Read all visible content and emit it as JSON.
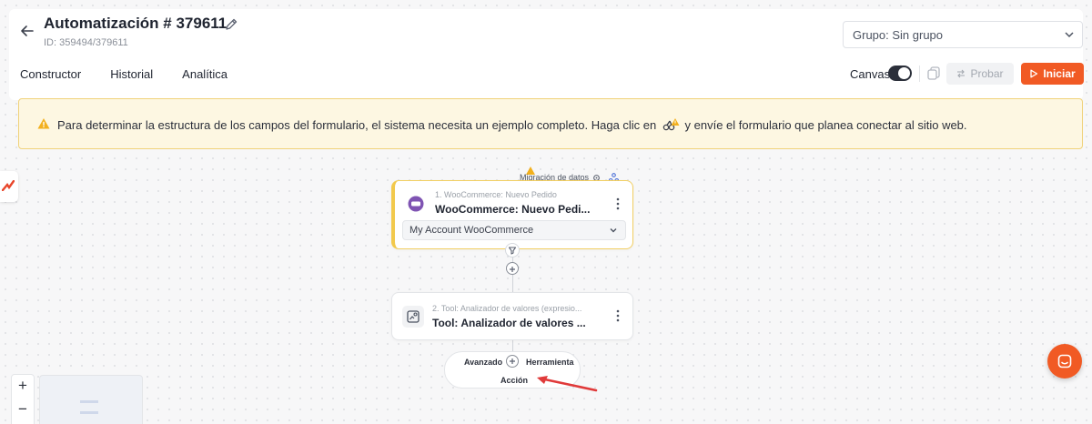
{
  "header": {
    "title": "Automatización # 379611",
    "id_text": "ID: 359494/379611",
    "group_select": "Grupo: Sin grupo"
  },
  "tabs": [
    {
      "label": "Constructor"
    },
    {
      "label": "Historial"
    },
    {
      "label": "Analítica"
    }
  ],
  "toolbar": {
    "canvas_label": "Canvas",
    "probar_label": "Probar",
    "iniciar_label": "Iniciar"
  },
  "alert": {
    "text_before": "Para determinar la estructura de los campos del formulario, el sistema necesita un ejemplo completo. Haga clic en",
    "text_after": "y envíe el formulario que planea conectar al sitio web."
  },
  "flow": {
    "migration_label": "Migración de datos",
    "node1": {
      "subtitle": "1. WooCommerce: Nuevo Pedido",
      "title": "WooCommerce: Nuevo Pedi...",
      "account": "My Account WooCommerce"
    },
    "node2": {
      "subtitle": "2. Tool: Analizador de valores (expresio...",
      "title": "Tool: Analizador de valores ..."
    },
    "add_menu": {
      "advanced": "Avanzado",
      "tool": "Herramienta",
      "action": "Acción"
    }
  },
  "zoom": {
    "in": "+",
    "out": "−"
  },
  "colors": {
    "accent": "#f15a24",
    "warning_bg": "#fdf7e2",
    "warning_border": "#f0d27a",
    "woo_purple": "#7f54b3"
  }
}
